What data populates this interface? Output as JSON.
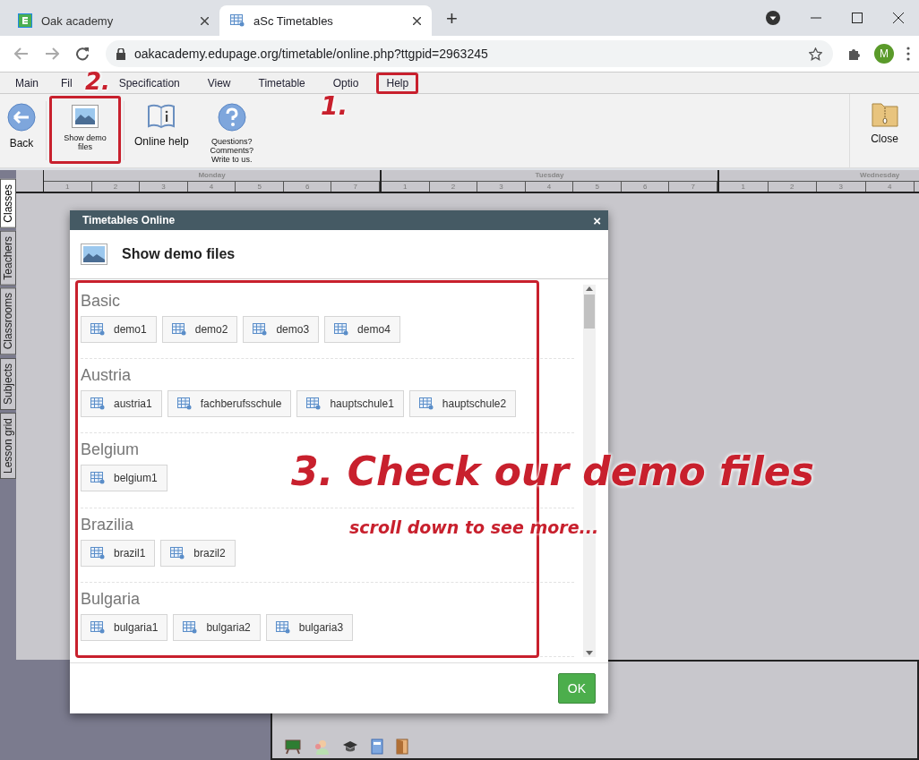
{
  "browser": {
    "tabs": [
      {
        "title": "Oak academy",
        "kind": "edupage",
        "selected": false
      },
      {
        "title": "aSc Timetables",
        "kind": "timetable",
        "selected": true
      }
    ],
    "new_tab": "+",
    "url": "oakacademy.edupage.org/timetable/online.php?ttgpid=2963245",
    "profile": "M"
  },
  "menu": [
    {
      "label": "Main",
      "highlighted": false
    },
    {
      "label": "Fil",
      "highlighted": false
    },
    {
      "label": "Specification",
      "highlighted": false
    },
    {
      "label": "View",
      "highlighted": false
    },
    {
      "label": "Timetable",
      "highlighted": false
    },
    {
      "label": "Optio",
      "highlighted": false
    },
    {
      "label": "Help",
      "highlighted": true
    }
  ],
  "toolbar": [
    {
      "label": "Back",
      "kind": "back",
      "highlighted": false
    },
    {
      "label": "Show demo files",
      "kind": "demo",
      "highlighted": true
    },
    {
      "label": "Online help",
      "kind": "book",
      "highlighted": false
    },
    {
      "label": "Questions? Comments? Write to us.",
      "kind": "question",
      "highlighted": false
    }
  ],
  "close_button": "Close",
  "timetable_header": {
    "days": [
      {
        "name": "Monday",
        "periods": [
          "1",
          "2",
          "3",
          "4",
          "5",
          "6",
          "7"
        ]
      },
      {
        "name": "Tuesday",
        "periods": [
          "1",
          "2",
          "3",
          "4",
          "5",
          "6",
          "7"
        ]
      },
      {
        "name": "Wednesday",
        "periods": [
          "1",
          "2",
          "3",
          "4"
        ]
      }
    ]
  },
  "side_tabs": [
    {
      "label": "Classes",
      "selected": true
    },
    {
      "label": "Teachers",
      "selected": false
    },
    {
      "label": "Classrooms",
      "selected": false
    },
    {
      "label": "Subjects",
      "selected": false
    },
    {
      "label": "Lesson grid",
      "selected": false
    }
  ],
  "dialog": {
    "title": "Timetables Online",
    "close": "×",
    "heading": "Show demo files",
    "groups": [
      {
        "name": "Basic",
        "files": [
          "demo1",
          "demo2",
          "demo3",
          "demo4"
        ]
      },
      {
        "name": "Austria",
        "files": [
          "austria1",
          "fachberufsschule",
          "hauptschule1",
          "hauptschule2"
        ]
      },
      {
        "name": "Belgium",
        "files": [
          "belgium1"
        ]
      },
      {
        "name": "Brazilia",
        "files": [
          "brazil1",
          "brazil2"
        ]
      },
      {
        "name": "Bulgaria",
        "files": [
          "bulgaria1",
          "bulgaria2",
          "bulgaria3"
        ]
      }
    ],
    "ok": "OK"
  },
  "annotations": [
    "1.",
    "2.",
    "3. Check our demo files",
    "scroll down to see more..."
  ]
}
